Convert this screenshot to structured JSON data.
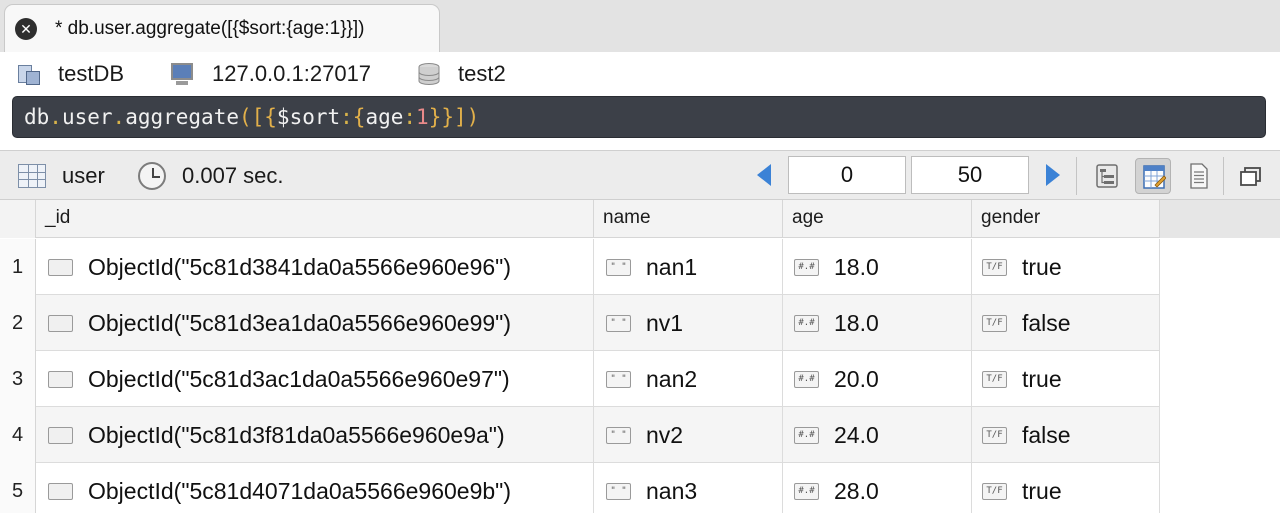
{
  "tab": {
    "close_glyph": "✕",
    "title": "* db.user.aggregate([{$sort:{age:1}}])"
  },
  "connection": {
    "database": "testDB",
    "host": "127.0.0.1:27017",
    "collection_db": "test2"
  },
  "query": {
    "parts": {
      "db": "db",
      "dot1": ".",
      "collection": "user",
      "dot2": ".",
      "fn": "aggregate",
      "open": "([{",
      "sort_key": "$sort",
      "colon1": ":",
      "brace_open": "{",
      "field": "age",
      "colon2": ":",
      "num": "1",
      "close": "}}])"
    }
  },
  "results_toolbar": {
    "collection": "user",
    "elapsed": "0.007 sec.",
    "skip": "0",
    "limit": "50"
  },
  "grid": {
    "columns": [
      "_id",
      "name",
      "age",
      "gender"
    ],
    "type_icons": {
      "objectid": "",
      "string": "\" \"",
      "number": "#.#",
      "boolean": "T/F"
    },
    "rows": [
      {
        "n": "1",
        "id": "ObjectId(\"5c81d3841da0a5566e960e96\")",
        "name": "nan1",
        "age": "18.0",
        "gender": "true"
      },
      {
        "n": "2",
        "id": "ObjectId(\"5c81d3ea1da0a5566e960e99\")",
        "name": "nv1",
        "age": "18.0",
        "gender": "false"
      },
      {
        "n": "3",
        "id": "ObjectId(\"5c81d3ac1da0a5566e960e97\")",
        "name": "nan2",
        "age": "20.0",
        "gender": "true"
      },
      {
        "n": "4",
        "id": "ObjectId(\"5c81d3f81da0a5566e960e9a\")",
        "name": "nv2",
        "age": "24.0",
        "gender": "false"
      },
      {
        "n": "5",
        "id": "ObjectId(\"5c81d4071da0a5566e960e9b\")",
        "name": "nan3",
        "age": "28.0",
        "gender": "true"
      }
    ]
  },
  "colors": {
    "query_bg": "#3c4048",
    "nav_arrow": "#3b82d6",
    "query_bracket": "#e2b04a",
    "query_number": "#e98a8a"
  }
}
